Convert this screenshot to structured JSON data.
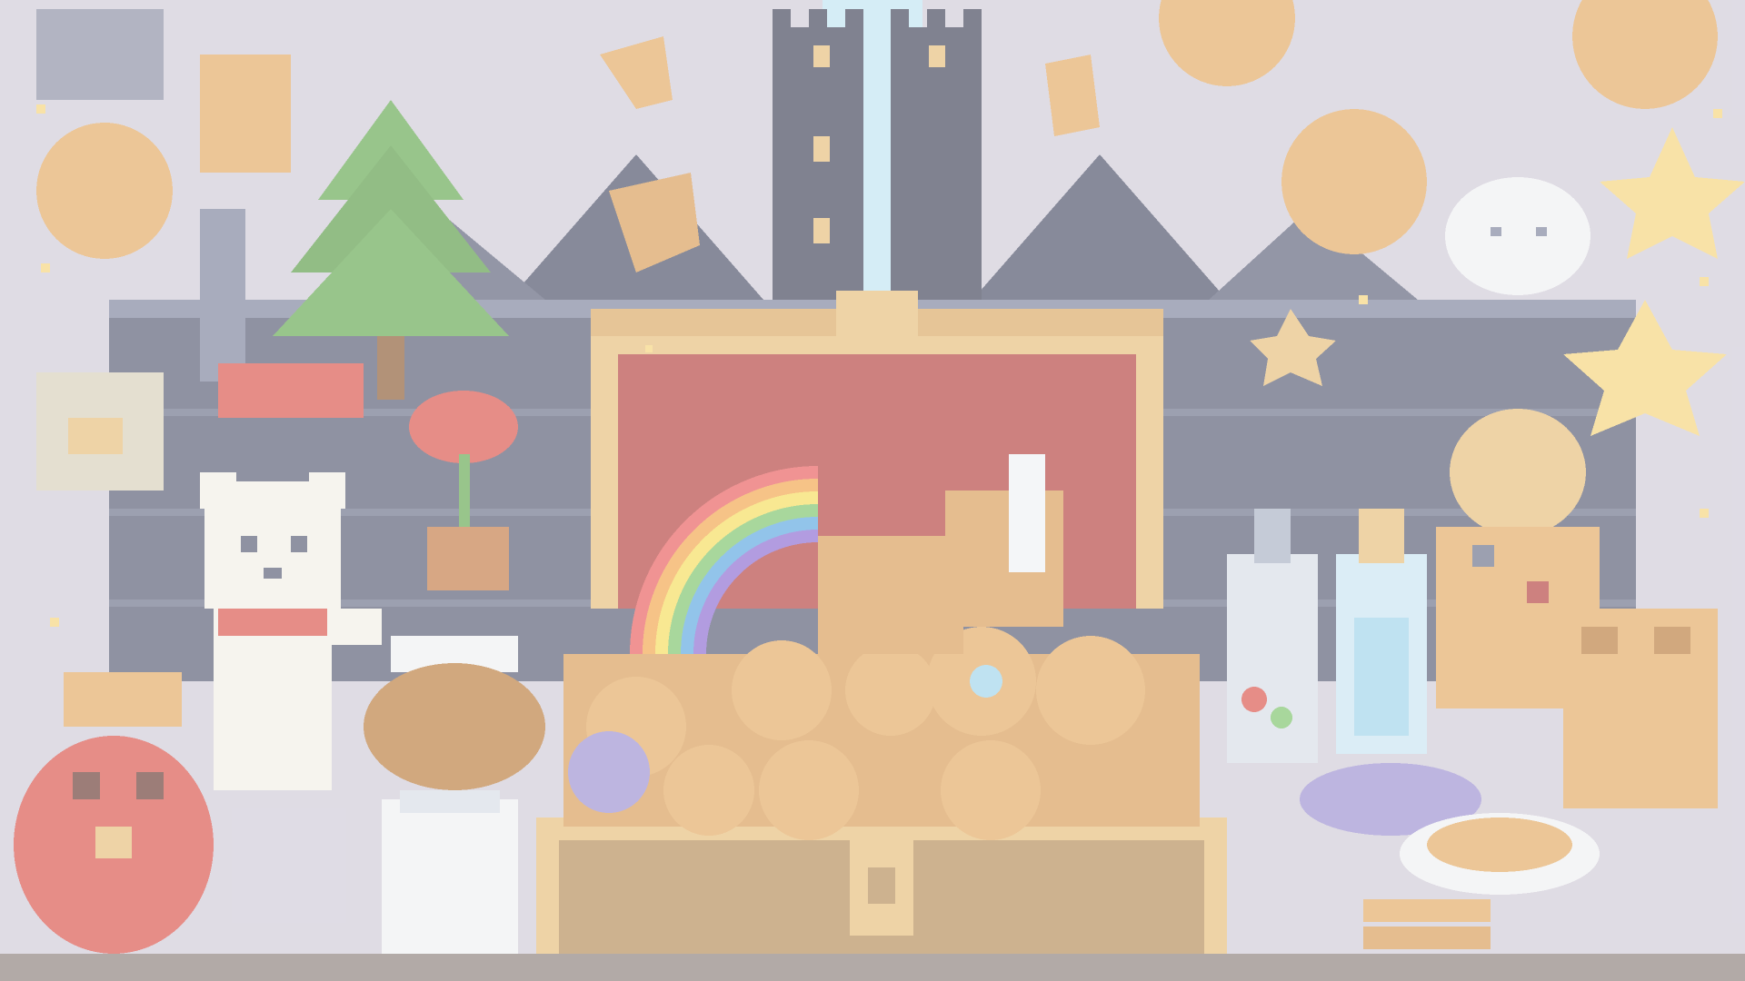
{
  "scene": {
    "name": "pixel-art-treasure-room",
    "palette": {
      "background": "#cfcad7",
      "stone_wall": "#555a73",
      "stone_light": "#7b819b",
      "roof": "#4a4e66",
      "chest_gold": "#e6bc78",
      "chest_wood": "#b48a55",
      "chest_inner": "#b3413e",
      "cookie": "#e3a961",
      "cookie_dark": "#b97b3c",
      "tree_green": "#63a84f",
      "bear_white": "#f2efe6",
      "bow_red": "#d9534a",
      "rainbow": [
        "#e85b5b",
        "#f2a54a",
        "#f4dc5a",
        "#7cc26a",
        "#5aa6e0",
        "#8a6ad0"
      ],
      "sky_light": "#bfe4f2",
      "sparkle": "#f5d47a",
      "potion_blue": "#9fd3ea",
      "purple": "#9b8fd0"
    },
    "items": [
      "treasure-chest",
      "cookie-pile",
      "rainbow",
      "castle-towers",
      "pine-tree",
      "teddy-bear",
      "red-rose",
      "honey-jar",
      "milk-jar",
      "red-vase",
      "potion-bottle",
      "tall-bottle",
      "golden-star",
      "moon-mask",
      "golden-robot",
      "cookie-stack",
      "waffle-cookie",
      "heart-cookie"
    ]
  }
}
